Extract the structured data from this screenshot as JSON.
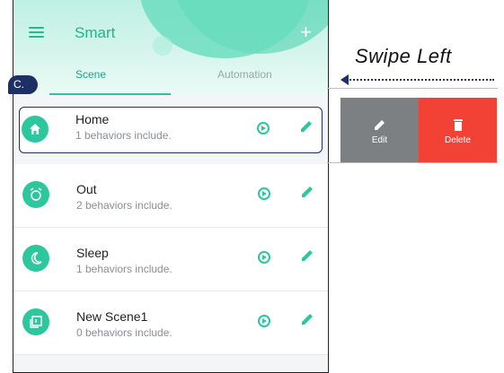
{
  "header": {
    "title": "Smart",
    "menu_icon": "menu-icon",
    "add_icon": "plus-icon"
  },
  "tabs": [
    {
      "label": "Scene",
      "active": true
    },
    {
      "label": "Automation",
      "active": false
    }
  ],
  "badge": "C.",
  "scenes": [
    {
      "title": "Home",
      "subtitle": "1 behaviors include.",
      "icon": "home-icon",
      "selected": true
    },
    {
      "title": "Out",
      "subtitle": "2 behaviors include.",
      "icon": "alarm-icon"
    },
    {
      "title": "Sleep",
      "subtitle": "1 behaviors include.",
      "icon": "moon-icon"
    },
    {
      "title": "New Scene1",
      "subtitle": "0 behaviors include.",
      "icon": "scene-icon"
    }
  ],
  "swipe": {
    "label": "Swipe Left",
    "edit_label": "Edit",
    "delete_label": "Delete"
  },
  "colors": {
    "accent": "#2dc79e",
    "edit": "#7d8083",
    "delete": "#f24236",
    "badge": "#1e2f66"
  }
}
